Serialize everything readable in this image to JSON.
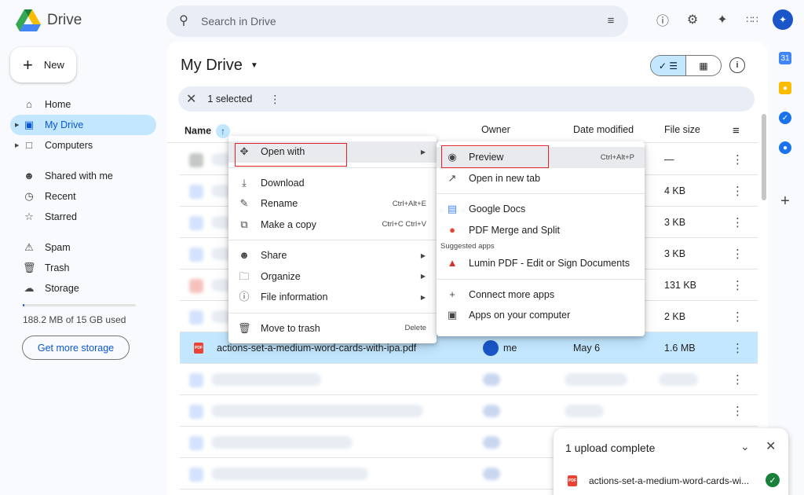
{
  "app": {
    "name": "Drive"
  },
  "search": {
    "placeholder": "Search in Drive"
  },
  "top_icons": [
    "help-icon",
    "settings-icon",
    "gemini-icon",
    "apps-grid-icon",
    "account-avatar"
  ],
  "sidebar": {
    "new_label": "New",
    "items": [
      {
        "label": "Home",
        "icon": "home-icon"
      },
      {
        "label": "My Drive",
        "icon": "my-drive-icon",
        "active": true
      },
      {
        "label": "Computers",
        "icon": "computers-icon"
      },
      {
        "label": "Shared with me",
        "icon": "shared-icon"
      },
      {
        "label": "Recent",
        "icon": "clock-icon"
      },
      {
        "label": "Starred",
        "icon": "star-icon"
      },
      {
        "label": "Spam",
        "icon": "spam-icon"
      },
      {
        "label": "Trash",
        "icon": "trash-icon"
      },
      {
        "label": "Storage",
        "icon": "cloud-icon"
      }
    ],
    "storage_used_fraction": 0.012,
    "storage_text": "188.2 MB of 15 GB used",
    "get_storage_label": "Get more storage"
  },
  "main": {
    "title": "My Drive",
    "selection_text": "1 selected",
    "columns": {
      "name": "Name",
      "owner": "Owner",
      "date": "Date modified",
      "size": "File size"
    },
    "rows": [
      {
        "size": "—"
      },
      {
        "size": "4 KB"
      },
      {
        "size": "3 KB"
      },
      {
        "size": "3 KB"
      },
      {
        "size": "131 KB"
      },
      {
        "size": "2 KB"
      },
      {
        "name": "actions-set-a-medium-word-cards-with-ipa.pdf",
        "owner": "me",
        "date": "May 6",
        "size": "1.6 MB",
        "selected": true
      },
      {
        "size": ""
      },
      {
        "size": ""
      },
      {
        "size": ""
      },
      {
        "size": ""
      }
    ]
  },
  "context_menu": {
    "open_with": "Open with",
    "download": "Download",
    "rename": "Rename",
    "rename_shortcut": "Ctrl+Alt+E",
    "make_copy": "Make a copy",
    "make_copy_shortcut": "Ctrl+C Ctrl+V",
    "share": "Share",
    "organize": "Organize",
    "file_information": "File information",
    "move_to_trash": "Move to trash",
    "move_to_trash_shortcut": "Delete"
  },
  "submenu": {
    "preview": "Preview",
    "preview_shortcut": "Ctrl+Alt+P",
    "open_new_tab": "Open in new tab",
    "google_docs": "Google Docs",
    "pdf_merge": "PDF Merge and Split",
    "suggested_apps": "Suggested apps",
    "lumin": "Lumin PDF - Edit or Sign Documents",
    "connect_more": "Connect more apps",
    "apps_on_computer": "Apps on your computer"
  },
  "upload_toast": {
    "title": "1 upload complete",
    "file": "actions-set-a-medium-word-cards-wi..."
  }
}
